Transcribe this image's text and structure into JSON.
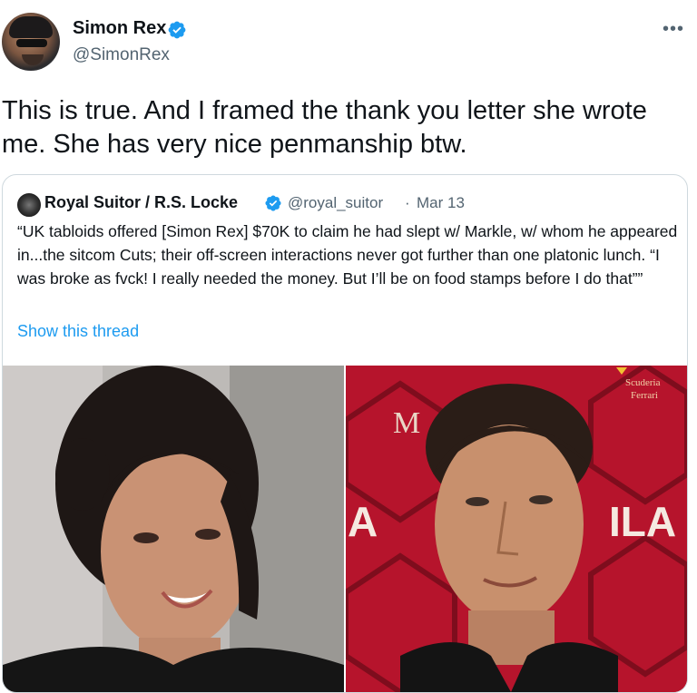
{
  "author": {
    "display_name": "Simon Rex",
    "handle": "@SimonRex",
    "verified": true
  },
  "tweet": {
    "text": "This is true. And I framed the thank you letter she wrote me. She has very nice penmanship btw."
  },
  "quoted_tweet": {
    "display_name": "Royal Suitor / R.S. Locke",
    "handle": "@royal_suitor",
    "separator": "·",
    "date": "Mar 13",
    "text": "“UK tabloids offered [Simon Rex] $70K to claim he had slept w/ Markle, w/ whom he appeared in...the sitcom Cuts; their off-screen interactions never got further than one platonic lunch. “I was broke as fvck! I really needed the money. But I’ll be on food stamps before I do that””",
    "show_thread_label": "Show this thread"
  },
  "photos": {
    "right_backdrop_text": {
      "m_letter": "M",
      "la_left": "A",
      "la_right": "ILA",
      "logo_line1": "Scuderia",
      "logo_line2": "Ferrari"
    }
  },
  "colors": {
    "verified_blue": "#1d9bf0",
    "link_blue": "#1d9bf0",
    "secondary_text": "#536471",
    "border": "#cfd9de",
    "backdrop_red": "#b8122a"
  },
  "icons": {
    "more": "more-horizontal-icon",
    "verified": "verified-badge-icon"
  }
}
